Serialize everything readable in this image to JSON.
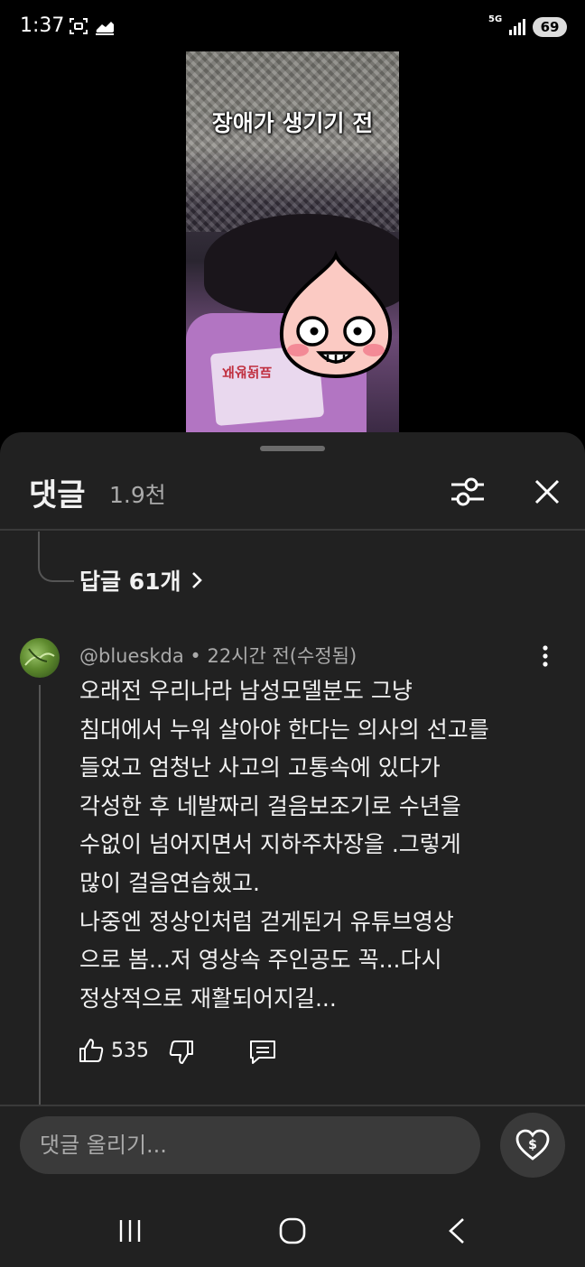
{
  "status_bar": {
    "time": "1:37",
    "network": "5G",
    "battery": "69"
  },
  "video": {
    "caption": "장애가 생기기 전",
    "sweater_text": "재생원료"
  },
  "comments_panel": {
    "title": "댓글",
    "count": "1.9천",
    "replies_link": "답글 61개",
    "comment": {
      "author": "@blueskda",
      "time": "22시간 전(수정됨)",
      "text": "오래전 우리나라 남성모델분도 그냥\n침대에서 누워 살아야 한다는 의사의 선고를\n들었고  엄청난 사고의 고통속에 있다가\n각성한 후 네발짜리 걸음보조기로 수년을\n수없이 넘어지면서 지하주차장을 .그렇게\n많이 걸음연습했고.\n나중엔 정상인처럼 걷게된거 유튜브영상\n으로 봄...저 영상속 주인공도 꼭...다시\n정상적으로 재활되어지길...",
      "likes": "535"
    },
    "input_placeholder": "댓글 올리기..."
  },
  "colors": {
    "background": "#000000",
    "sheet": "#212121",
    "input": "#3a3a3a",
    "secondary_text": "#aaaaaa"
  }
}
